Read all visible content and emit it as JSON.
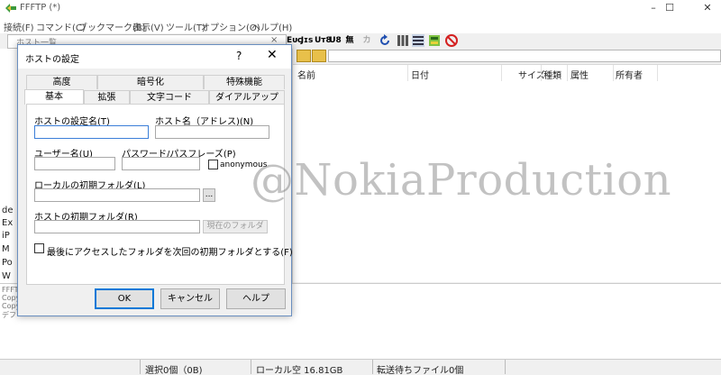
{
  "app": {
    "title": "FFFTP (*)"
  },
  "window_controls": {
    "minimize": "–",
    "maximize": "☐",
    "close": "✕"
  },
  "menu": [
    "接続(F)",
    "コマンド(C)",
    "ブックマーク(B)",
    "表示(V)",
    "ツール(T)",
    "オプション(O)",
    "ヘルプ(H)"
  ],
  "toolbar": {
    "icons": [
      "Ex",
      "Jis",
      "Utf8",
      "Utf8",
      "無",
      "カ",
      "refresh-icon",
      "list-icon",
      "detail-icon",
      "sync-icon",
      "stop-icon"
    ],
    "labels": {
      "ex": "Eᴜc",
      "jis": "Jɪs",
      "utf8n": "Uᴛ8",
      "utf8b": "U8",
      "none": "無",
      "kana": "カ"
    }
  },
  "host_list_window": {
    "title": "ホスト一覧",
    "close": "×"
  },
  "local_pane": {
    "items": [
      "de",
      "Ex",
      "iP",
      "M",
      "Po",
      "W"
    ]
  },
  "remote_pane": {
    "columns": [
      "名前",
      "日付",
      "サイズ",
      "種類",
      "属性",
      "所有者"
    ]
  },
  "log": {
    "lines": [
      "FFFT",
      "Copy",
      "Copy",
      "デフ"
    ]
  },
  "status_bar": {
    "selection": "選択0個（0B)",
    "local_free": "ローカル空 16.81GB",
    "queue": "転送待ちファイル0個"
  },
  "dialog": {
    "title": "ホストの設定",
    "help_glyph": "?",
    "close_glyph": "✕",
    "tabs_back": [
      "高度",
      "暗号化",
      "特殊機能"
    ],
    "tabs_front": [
      "基本",
      "拡張",
      "文字コード",
      "ダイアルアップ"
    ],
    "active_tab": "基本",
    "fields": {
      "setting_name": {
        "label": "ホストの設定名(T)",
        "value": ""
      },
      "host_name": {
        "label": "ホスト名（アドレス)(N)",
        "value": ""
      },
      "user_name": {
        "label": "ユーザー名(U)",
        "value": ""
      },
      "password": {
        "label": "パスワード/パスフレーズ(P)",
        "value": ""
      },
      "anonymous": {
        "label": "anonymous",
        "checked": false
      },
      "local_folder": {
        "label": "ローカルの初期フォルダ(L)",
        "value": "",
        "browse": "..."
      },
      "host_folder": {
        "label": "ホストの初期フォルダ(R)",
        "value": "",
        "current_button": "現在のフォルダ"
      },
      "last_folder": {
        "label": "最後にアクセスしたフォルダを次回の初期フォルダとする(F)",
        "checked": false
      }
    },
    "buttons": {
      "ok": "OK",
      "cancel": "キャンセル",
      "help": "ヘルプ"
    }
  },
  "watermark": "@NokiaProduction"
}
